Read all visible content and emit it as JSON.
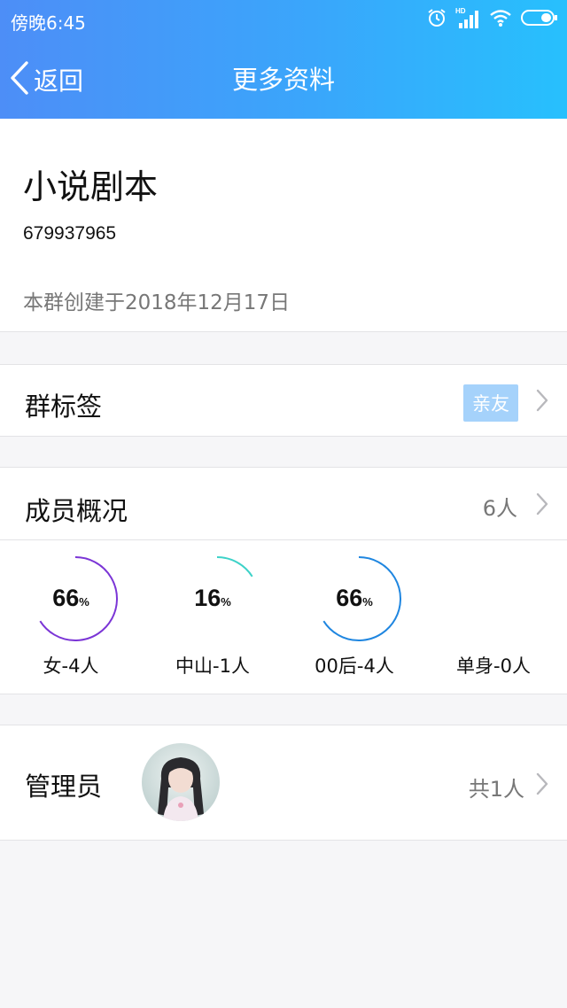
{
  "status_bar": {
    "time": "傍晚6:45",
    "network_badge": "HD",
    "icons": [
      "alarm-icon",
      "signal-icon",
      "wifi-icon",
      "battery-icon"
    ]
  },
  "nav": {
    "back_label": "返回",
    "title": "更多资料"
  },
  "group": {
    "name": "小说剧本",
    "id": "679937965",
    "created": "本群创建于2018年12月17日"
  },
  "tags_row": {
    "label": "群标签",
    "tag": "亲友"
  },
  "members_row": {
    "label": "成员概况",
    "count": "6人"
  },
  "member_stats": [
    {
      "percent": 66,
      "percent_text": "66",
      "unit": "%",
      "label": "女-4人",
      "color": "#7b35d6"
    },
    {
      "percent": 16,
      "percent_text": "16",
      "unit": "%",
      "label": "中山-1人",
      "color": "#3dd2c8"
    },
    {
      "percent": 66,
      "percent_text": "66",
      "unit": "%",
      "label": "00后-4人",
      "color": "#1f86e0"
    },
    {
      "label": "单身-0人"
    }
  ],
  "admin_row": {
    "label": "管理员",
    "total": "共1人"
  },
  "colors": {
    "header_gradient_start": "#4d8ef7",
    "header_gradient_end": "#27c0fd",
    "page_background": "#f6f6f8",
    "tag_background": "#a5d2fb"
  }
}
